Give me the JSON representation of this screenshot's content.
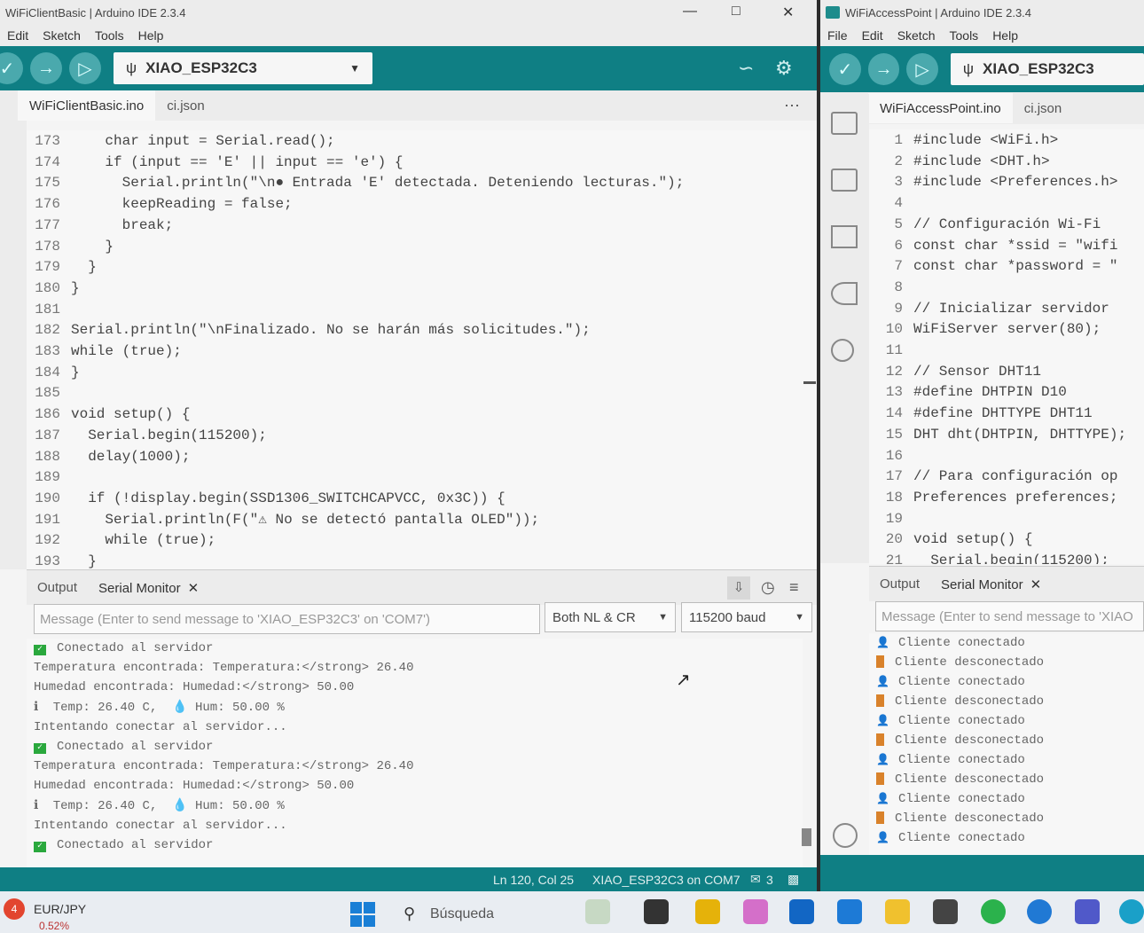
{
  "left": {
    "title": "WiFiClientBasic | Arduino IDE 2.3.4",
    "menu": [
      "Edit",
      "Sketch",
      "Tools",
      "Help"
    ],
    "board": "XIAO_ESP32C3",
    "tabs": [
      "WiFiClientBasic.ino",
      "ci.json"
    ],
    "code": [
      {
        "n": "173",
        "t": "    char input = Serial.read();"
      },
      {
        "n": "174",
        "t": "    if (input == 'E' || input == 'e') {"
      },
      {
        "n": "175",
        "t": "      Serial.println(\"\\n● Entrada 'E' detectada. Deteniendo lecturas.\");"
      },
      {
        "n": "176",
        "t": "      keepReading = false;"
      },
      {
        "n": "177",
        "t": "      break;"
      },
      {
        "n": "178",
        "t": "    }"
      },
      {
        "n": "179",
        "t": "  }"
      },
      {
        "n": "180",
        "t": "}"
      },
      {
        "n": "181",
        "t": ""
      },
      {
        "n": "182",
        "t": "Serial.println(\"\\nFinalizado. No se harán más solicitudes.\");"
      },
      {
        "n": "183",
        "t": "while (true);"
      },
      {
        "n": "184",
        "t": "}"
      },
      {
        "n": "185",
        "t": ""
      },
      {
        "n": "186",
        "t": "void setup() {"
      },
      {
        "n": "187",
        "t": "  Serial.begin(115200);"
      },
      {
        "n": "188",
        "t": "  delay(1000);"
      },
      {
        "n": "189",
        "t": ""
      },
      {
        "n": "190",
        "t": "  if (!display.begin(SSD1306_SWITCHCAPVCC, 0x3C)) {"
      },
      {
        "n": "191",
        "t": "    Serial.println(F(\"⚠ No se detectó pantalla OLED\"));"
      },
      {
        "n": "192",
        "t": "    while (true);"
      },
      {
        "n": "193",
        "t": "  }"
      }
    ],
    "panel_tabs": {
      "output": "Output",
      "serial": "Serial Monitor",
      "close": "✕"
    },
    "message_placeholder": "Message (Enter to send message to 'XIAO_ESP32C3' on 'COM7')",
    "line_ending": "Both NL & CR",
    "baud": "115200 baud",
    "serial": [
      {
        "icon": "ok",
        "t": "Conectado al servidor"
      },
      {
        "icon": "",
        "t": "Temperatura encontrada: Temperatura:</strong> 26.40"
      },
      {
        "icon": "",
        "t": "Humedad encontrada: Humedad:</strong> 50.00"
      },
      {
        "icon": "temp",
        "t": "Temp: 26.40 C,  💧 Hum: 50.00 %"
      },
      {
        "icon": "",
        "t": "Intentando conectar al servidor..."
      },
      {
        "icon": "ok",
        "t": "Conectado al servidor"
      },
      {
        "icon": "",
        "t": "Temperatura encontrada: Temperatura:</strong> 26.40"
      },
      {
        "icon": "",
        "t": "Humedad encontrada: Humedad:</strong> 50.00"
      },
      {
        "icon": "temp",
        "t": "Temp: 26.40 C,  💧 Hum: 50.00 %"
      },
      {
        "icon": "",
        "t": "Intentando conectar al servidor..."
      },
      {
        "icon": "ok",
        "t": "Conectado al servidor"
      }
    ],
    "status": {
      "pos": "Ln 120, Col 25",
      "board": "XIAO_ESP32C3 on COM7",
      "notif": "3"
    }
  },
  "right": {
    "title": "WiFiAccessPoint | Arduino IDE 2.3.4",
    "menu": [
      "File",
      "Edit",
      "Sketch",
      "Tools",
      "Help"
    ],
    "board": "XIAO_ESP32C3",
    "tabs": [
      "WiFiAccessPoint.ino",
      "ci.json"
    ],
    "code": [
      {
        "n": "1",
        "t": "#include <WiFi.h>"
      },
      {
        "n": "2",
        "t": "#include <DHT.h>"
      },
      {
        "n": "3",
        "t": "#include <Preferences.h>"
      },
      {
        "n": "4",
        "t": ""
      },
      {
        "n": "5",
        "t": "// Configuración Wi-Fi"
      },
      {
        "n": "6",
        "t": "const char *ssid = \"wifi"
      },
      {
        "n": "7",
        "t": "const char *password = \""
      },
      {
        "n": "8",
        "t": ""
      },
      {
        "n": "9",
        "t": "// Inicializar servidor"
      },
      {
        "n": "10",
        "t": "WiFiServer server(80);"
      },
      {
        "n": "11",
        "t": ""
      },
      {
        "n": "12",
        "t": "// Sensor DHT11"
      },
      {
        "n": "13",
        "t": "#define DHTPIN D10"
      },
      {
        "n": "14",
        "t": "#define DHTTYPE DHT11"
      },
      {
        "n": "15",
        "t": "DHT dht(DHTPIN, DHTTYPE);"
      },
      {
        "n": "16",
        "t": ""
      },
      {
        "n": "17",
        "t": "// Para configuración op"
      },
      {
        "n": "18",
        "t": "Preferences preferences;"
      },
      {
        "n": "19",
        "t": ""
      },
      {
        "n": "20",
        "t": "void setup() {"
      },
      {
        "n": "21",
        "t": "  Serial.begin(115200);"
      }
    ],
    "panel_tabs": {
      "output": "Output",
      "serial": "Serial Monitor",
      "close": "✕"
    },
    "message_placeholder": "Message (Enter to send message to 'XIAO",
    "serial": [
      {
        "icon": "person",
        "t": "Cliente conectado"
      },
      {
        "icon": "door",
        "t": "Cliente desconectado"
      },
      {
        "icon": "person",
        "t": "Cliente conectado"
      },
      {
        "icon": "door",
        "t": "Cliente desconectado"
      },
      {
        "icon": "person",
        "t": "Cliente conectado"
      },
      {
        "icon": "door",
        "t": "Cliente desconectado"
      },
      {
        "icon": "person",
        "t": "Cliente conectado"
      },
      {
        "icon": "door",
        "t": "Cliente desconectado"
      },
      {
        "icon": "person",
        "t": "Cliente conectado"
      },
      {
        "icon": "door",
        "t": "Cliente desconectado"
      },
      {
        "icon": "person",
        "t": "Cliente conectado"
      }
    ]
  },
  "taskbar": {
    "widget_title": "EUR/JPY",
    "widget_value": "0.52%",
    "widget_badge": "4",
    "search": "Búsqueda"
  },
  "colors": {
    "teal": "#0f7f84",
    "orange": "#d35400"
  }
}
